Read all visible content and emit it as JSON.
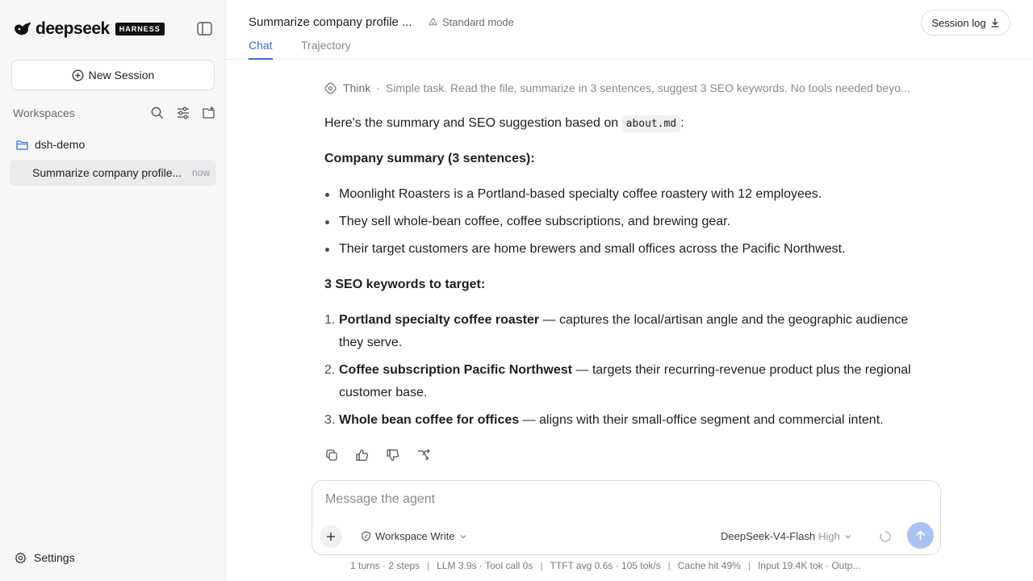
{
  "brand": {
    "name": "deepseek",
    "badge": "HARNESS"
  },
  "sidebar": {
    "new_session_label": "New Session",
    "workspaces_label": "Workspaces",
    "folder": {
      "name": "dsh-demo"
    },
    "session": {
      "title": "Summarize company profile...",
      "time": "now"
    },
    "settings_label": "Settings"
  },
  "header": {
    "title": "Summarize company profile ...",
    "mode": "Standard mode",
    "session_log_label": "Session log",
    "tabs": [
      {
        "label": "Chat",
        "active": true
      },
      {
        "label": "Trajectory",
        "active": false
      }
    ]
  },
  "message": {
    "think_label": "Think",
    "think_text": "Simple task. Read the file, summarize in 3 sentences, suggest 3 SEO keywords. No tools needed beyo...",
    "intro_before": "Here's the summary and SEO suggestion based on ",
    "intro_code": "about.md",
    "intro_after": ":",
    "summary_heading": "Company summary (3 sentences):",
    "summary_bullets": [
      "Moonlight Roasters is a Portland-based specialty coffee roastery with 12 employees.",
      "They sell whole-bean coffee, coffee subscriptions, and brewing gear.",
      "Their target customers are home brewers and small offices across the Pacific Northwest."
    ],
    "keywords_heading": "3 SEO keywords to target:",
    "keywords": [
      {
        "marker": "1.",
        "keyword": "Portland specialty coffee roaster",
        "detail": " — captures the local/artisan angle and the geographic audience they serve."
      },
      {
        "marker": "2.",
        "keyword": "Coffee subscription Pacific Northwest",
        "detail": " — targets their recurring-revenue product plus the regional customer base."
      },
      {
        "marker": "3.",
        "keyword": "Whole bean coffee for offices",
        "detail": " — aligns with their small-office segment and commercial intent."
      }
    ]
  },
  "composer": {
    "placeholder": "Message the agent",
    "permission": "Workspace Write",
    "model": "DeepSeek-V4-Flash",
    "effort": "High"
  },
  "status": {
    "turns": "1 turns · 2 steps",
    "llm": "LLM 3.9s · Tool call 0s",
    "ttft": "TTFT avg 0.6s · 105 tok/s",
    "cache": "Cache hit 49%",
    "tokens": "Input 19.4K tok · Outp..."
  },
  "colors": {
    "accent": "#3b6fd4",
    "send": "#a9c1f3"
  }
}
